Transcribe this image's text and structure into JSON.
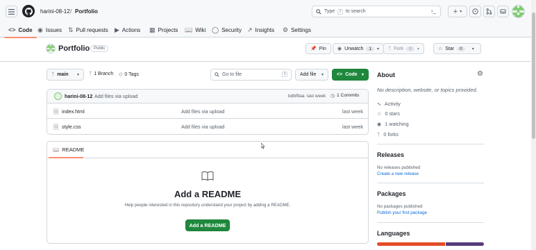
{
  "header": {
    "owner": "harini-08-12",
    "separator": "/",
    "repo": "Portfolio",
    "search_prefix": "Type",
    "search_key": "/",
    "search_suffix": "to search",
    "plus_label": "+",
    "dropdown_caret": "▾"
  },
  "nav": {
    "tabs": [
      {
        "label": "Code",
        "icon": "code-icon"
      },
      {
        "label": "Issues",
        "icon": "issue-icon"
      },
      {
        "label": "Pull requests",
        "icon": "pull-request-icon"
      },
      {
        "label": "Actions",
        "icon": "actions-icon"
      },
      {
        "label": "Projects",
        "icon": "projects-icon"
      },
      {
        "label": "Wiki",
        "icon": "book-icon"
      },
      {
        "label": "Security",
        "icon": "shield-icon"
      },
      {
        "label": "Insights",
        "icon": "graph-icon"
      },
      {
        "label": "Settings",
        "icon": "gear-icon"
      }
    ]
  },
  "repo": {
    "name": "Portfolio",
    "visibility": "Public",
    "pin": "Pin",
    "unwatch": "Unwatch",
    "watch_count": "1",
    "fork": "Fork",
    "fork_count": "0",
    "star": "Star",
    "star_count": "0"
  },
  "toolbar": {
    "branch": "main",
    "branches": "1 Branch",
    "tags": "0 Tags",
    "goto_placeholder": "Go to file",
    "goto_key": "t",
    "add_file": "Add file",
    "code": "Code"
  },
  "commit": {
    "author": "harini-08-12",
    "message": "Add files via upload",
    "hash": "bdbf9aa",
    "dot": "·",
    "time": "last week",
    "commits": "1 Commits"
  },
  "files": [
    {
      "name": "index.html",
      "message": "Add files via upload",
      "time": "last week"
    },
    {
      "name": "style.css",
      "message": "Add files via upload",
      "time": "last week"
    }
  ],
  "readme": {
    "tab": "README",
    "heading": "Add a README",
    "help": "Help people interested in this repository understand your project by adding a README.",
    "button": "Add a README"
  },
  "about": {
    "title": "About",
    "description": "No description, website, or topics provided.",
    "activity": "Activity",
    "stars": "0 stars",
    "watching": "1 watching",
    "forks": "0 forks"
  },
  "releases": {
    "title": "Releases",
    "empty": "No releases published",
    "link": "Create a new release"
  },
  "packages": {
    "title": "Packages",
    "empty": "No packages published",
    "link": "Publish your first package"
  },
  "languages": {
    "title": "Languages",
    "bar": [
      {
        "share": 0.64,
        "color": "#e34c26"
      },
      {
        "share": 0.36,
        "color": "#563d7c"
      }
    ]
  }
}
